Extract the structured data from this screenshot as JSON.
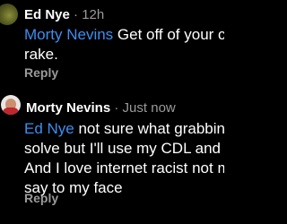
{
  "comments": [
    {
      "author": "Ed Nye",
      "separator": "·",
      "time": "12h",
      "mention": "Morty Nevins",
      "text": " Get off of your couch a rake.",
      "reply_label": "Reply",
      "avatar_icon": "user-photo-icon"
    },
    {
      "author": "Morty Nevins",
      "separator": "·",
      "time": "Just now",
      "mention": "Ed Nye",
      "text": " not sure what grabbing a ra solve but I'll use my CDL and go to And I love internet racist not man e say to my face",
      "reply_label": "Reply",
      "avatar_icon": "user-photo-icon"
    }
  ],
  "colors": {
    "background": "#000000",
    "text": "#ffffff",
    "mention": "#3d8ef0",
    "muted": "#9a9a9a"
  }
}
